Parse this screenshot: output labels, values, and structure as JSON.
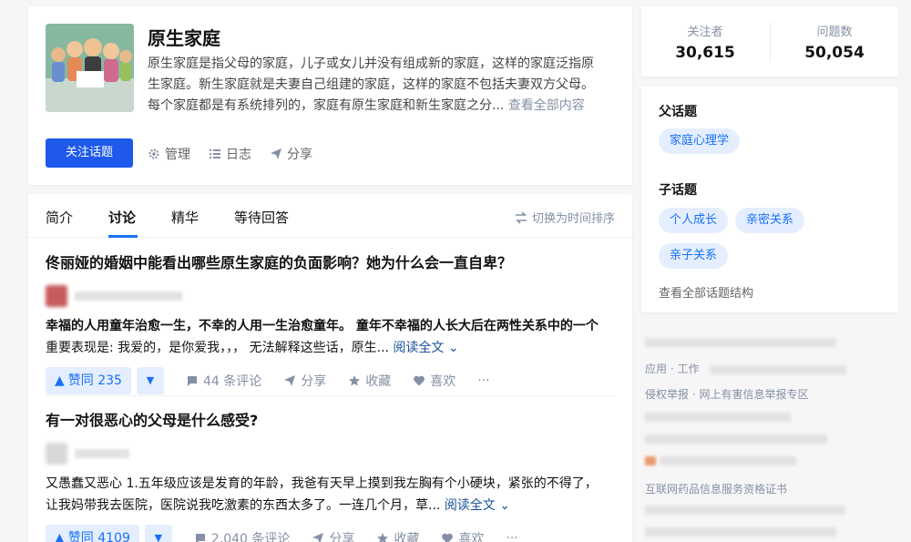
{
  "topic": {
    "title": "原生家庭",
    "desc_1": "原生家庭是指父母的家庭，儿子或女儿并没有组成新的家庭，这样的家庭泛指原",
    "desc_2": "生家庭。新生家庭就是夫妻自己组建的家庭，这样的家庭不包括夫妻双方父母。",
    "desc_3": "每个家庭都是有系统排列的，家庭有原生家庭和新生家庭之分...",
    "see_more": "查看全部内容",
    "follow_label": "关注话题",
    "actions": {
      "manage": "管理",
      "log": "日志",
      "share": "分享"
    }
  },
  "stats": {
    "followers_label": "关注者",
    "followers": "30,615",
    "questions_label": "问题数",
    "questions": "50,054"
  },
  "related": {
    "parent_title": "父话题",
    "parent_tags": [
      "家庭心理学"
    ],
    "child_title": "子话题",
    "child_tags": [
      "个人成长",
      "亲密关系",
      "亲子关系"
    ],
    "see_all": "查看全部话题结构"
  },
  "footer": {
    "line1_a": "应用",
    "line1_b": "工作",
    "line2_a": "侵权举报",
    "line2_b": "网上有害信息举报专区",
    "line3": "互联网药品信息服务资格证书"
  },
  "tabs": [
    "简介",
    "讨论",
    "精华",
    "等待回答"
  ],
  "sort_label": "切换为时间排序",
  "feed": [
    {
      "title": "佟丽娅的婚姻中能看出哪些原生家庭的负面影响？她为什么会一直自卑？",
      "excerpt_1": "幸福的人用童年治愈一生，不幸的人用一生治愈童年。 童年不幸福的人长大后在两性关系中的一个",
      "excerpt_2": "重要表现是: 我爱的，是你爱我，，， 无法解释这些话，原生...",
      "read_more": "阅读全文",
      "votes": "赞同 235",
      "comments": "44 条评论",
      "share": "分享",
      "collect": "收藏",
      "like": "喜欢",
      "avatar_color": "#c65c5c"
    },
    {
      "title": "有一对很恶心的父母是什么感受?",
      "excerpt_1": "又愚蠢又恶心 1.五年级应该是发育的年龄，我爸有天早上摸到我左胸有个小硬块，紧张的不得了，",
      "excerpt_2": "让我妈带我去医院，医院说我吃激素的东西太多了。一连几个月，草...",
      "read_more": "阅读全文",
      "votes": "赞同 4109",
      "comments": "2,040 条评论",
      "share": "分享",
      "collect": "收藏",
      "like": "喜欢",
      "avatar_color": "#d8d8d8"
    }
  ]
}
